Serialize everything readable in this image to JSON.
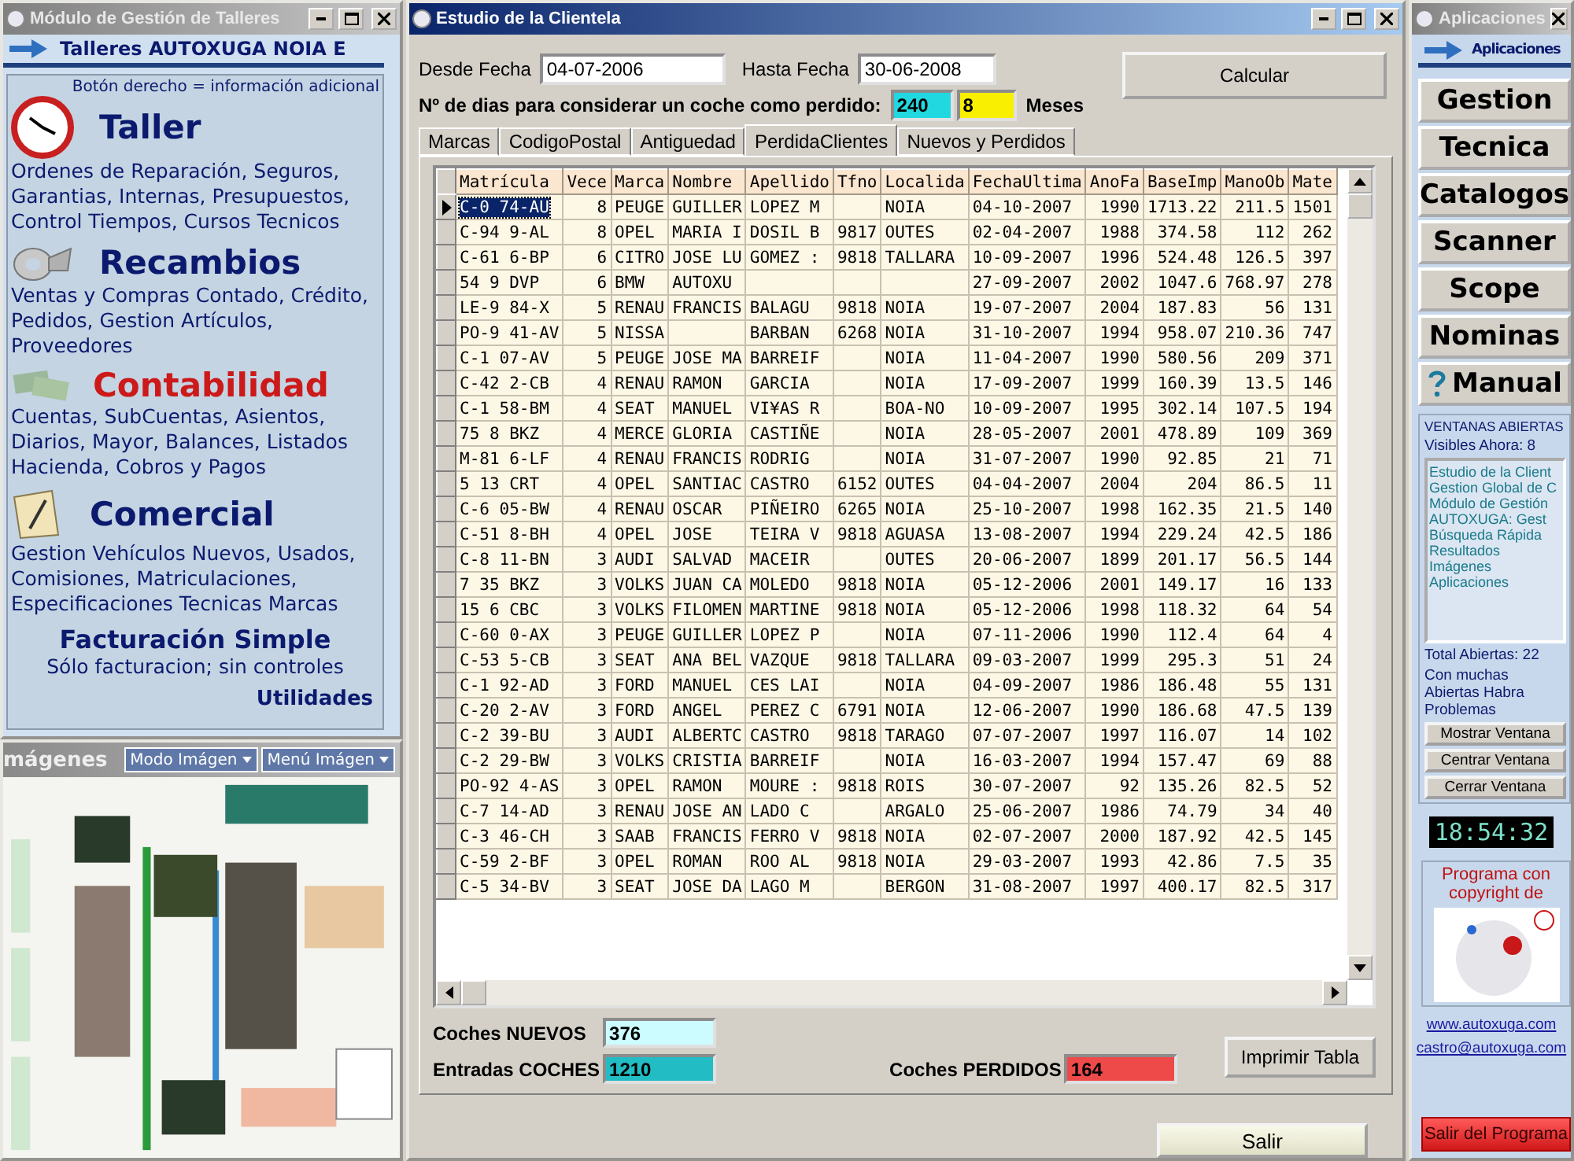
{
  "left_window": {
    "title": "Módulo de Gestión de Talleres",
    "header": "Talleres AUTOXUGA NOIA E",
    "hint": "Botón derecho = información adicional",
    "modules": [
      {
        "title": "Taller",
        "kind": "clock",
        "color": "#0b1a6e",
        "description": "Ordenes de Reparación, Seguros, Garantias, Internas, Presupuestos, Control Tiempos, Cursos Tecnicos"
      },
      {
        "title": "Recambios",
        "kind": "part",
        "color": "#0b1a6e",
        "description": "Ventas y Compras Contado, Crédito, Pedidos,  Gestion Artículos, Proveedores"
      },
      {
        "title": "Contabilidad",
        "kind": "money",
        "color": "#cc1a1a",
        "description": "Cuentas, SubCuentas, Asientos, Diarios, Mayor, Balances, Listados Hacienda, Cobros y Pagos"
      },
      {
        "title": "Comercial",
        "kind": "notepad",
        "color": "#0b1a6e",
        "description": "Gestion Vehículos Nuevos, Usados, Comisiones, Matriculaciones, Especificaciones Tecnicas Marcas"
      }
    ],
    "simple": {
      "title": "Facturación Simple",
      "description": "Sólo facturacion; sin controles"
    },
    "utilities": "Utilidades"
  },
  "images_window": {
    "title": "mágenes",
    "menus": [
      "Modo Imágen",
      "Menú Imágen"
    ]
  },
  "main_window": {
    "title": "Estudio de la Clientela",
    "from": {
      "label": "Desde Fecha",
      "value": "04-07-2006"
    },
    "to": {
      "label": "Hasta Fecha",
      "value": "30-06-2008"
    },
    "days_label": "Nº de dias para considerar un coche como perdido:",
    "days": "240",
    "months": "8",
    "months_label": "Meses",
    "calc_button": "Calcular",
    "tabs": [
      {
        "label": "Marcas",
        "selected": false
      },
      {
        "label": "CodigoPostal",
        "selected": false
      },
      {
        "label": "Antiguedad",
        "selected": false
      },
      {
        "label": "PerdidaClientes",
        "selected": true
      },
      {
        "label": "Nuevos y Perdidos",
        "selected": false
      }
    ],
    "table": {
      "columns": [
        "Matrícula",
        "Vece",
        "Marca",
        "Nombre",
        "Apellido",
        "Tfno",
        "Localida",
        "FechaUltima",
        "AnoFa",
        "BaseImp",
        "ManoOb",
        "Mate"
      ],
      "rows": [
        {
          "selected": true,
          "cells": [
            "C-0 74-AU",
            "8",
            "PEUGE",
            "GUILLER",
            "LOPEZ M",
            null,
            "NOIA",
            "04-10-2007",
            "1990",
            "1713.22",
            "211.5",
            "1501"
          ]
        },
        {
          "selected": false,
          "cells": [
            "C-94 9-AL",
            "8",
            "OPEL",
            "MARIA I",
            "DOSIL B",
            "9817",
            "OUTES",
            "02-04-2007",
            "1988",
            "374.58",
            "112",
            "262"
          ]
        },
        {
          "selected": false,
          "cells": [
            "C-61 6-BP",
            "6",
            "CITRO",
            "JOSE LU",
            "GOMEZ :",
            "9818",
            "TALLARA",
            "10-09-2007",
            "1996",
            "524.48",
            "126.5",
            "397"
          ]
        },
        {
          "selected": false,
          "cells": [
            "54 9 DVP",
            "6",
            "BMW",
            "AUTOXU",
            null,
            null,
            null,
            "27-09-2007",
            "2002",
            "1047.6",
            "768.97",
            "278"
          ]
        },
        {
          "selected": false,
          "cells": [
            "LE-9 84-X",
            "5",
            "RENAU",
            "FRANCIS",
            "BALAGU",
            "9818",
            "NOIA",
            "19-07-2007",
            "2004",
            "187.83",
            "56",
            "131"
          ]
        },
        {
          "selected": false,
          "cells": [
            "PO-9 41-AV",
            "5",
            "NISSA",
            null,
            "BARBAN",
            "6268",
            "NOIA",
            "31-10-2007",
            "1994",
            "958.07",
            "210.36",
            "747"
          ]
        },
        {
          "selected": false,
          "cells": [
            "C-1 07-AV",
            "5",
            "PEUGE",
            "JOSE MA",
            "BARREIF",
            null,
            "NOIA",
            "11-04-2007",
            "1990",
            "580.56",
            "209",
            "371"
          ]
        },
        {
          "selected": false,
          "cells": [
            "C-42 2-CB",
            "4",
            "RENAU",
            "RAMON",
            "GARCIA",
            null,
            "NOIA",
            "17-09-2007",
            "1999",
            "160.39",
            "13.5",
            "146"
          ]
        },
        {
          "selected": false,
          "cells": [
            "C-1 58-BM",
            "4",
            "SEAT",
            "MANUEL",
            "VI¥AS R",
            null,
            "BOA-NO",
            "10-09-2007",
            "1995",
            "302.14",
            "107.5",
            "194"
          ]
        },
        {
          "selected": false,
          "cells": [
            "75 8 BKZ",
            "4",
            "MERCE",
            "GLORIA",
            "CASTIÑE",
            null,
            "NOIA",
            "28-05-2007",
            "2001",
            "478.89",
            "109",
            "369"
          ]
        },
        {
          "selected": false,
          "cells": [
            "M-81 6-LF",
            "4",
            "RENAU",
            "FRANCIS",
            "RODRIG",
            null,
            "NOIA",
            "31-07-2007",
            "1990",
            "92.85",
            "21",
            "71"
          ]
        },
        {
          "selected": false,
          "cells": [
            "5 13 CRT",
            "4",
            "OPEL",
            "SANTIAC",
            "CASTRO",
            "6152",
            "OUTES",
            "04-04-2007",
            "2004",
            "204",
            "86.5",
            "11"
          ]
        },
        {
          "selected": false,
          "cells": [
            "C-6 05-BW",
            "4",
            "RENAU",
            "OSCAR",
            "PIÑEIRO",
            "6265",
            "NOIA",
            "25-10-2007",
            "1998",
            "162.35",
            "21.5",
            "140"
          ]
        },
        {
          "selected": false,
          "cells": [
            "C-51 8-BH",
            "4",
            "OPEL",
            "JOSE",
            "TEIRA V",
            "9818",
            "AGUASA",
            "13-08-2007",
            "1994",
            "229.24",
            "42.5",
            "186"
          ]
        },
        {
          "selected": false,
          "cells": [
            "C-8 11-BN",
            "3",
            "AUDI",
            "SALVAD",
            "MACEIR",
            null,
            "OUTES",
            "20-06-2007",
            "1899",
            "201.17",
            "56.5",
            "144"
          ]
        },
        {
          "selected": false,
          "cells": [
            "7 35 BKZ",
            "3",
            "VOLKS",
            "JUAN CA",
            "MOLEDO",
            "9818",
            "NOIA",
            "05-12-2006",
            "2001",
            "149.17",
            "16",
            "133"
          ]
        },
        {
          "selected": false,
          "cells": [
            "15 6 CBC",
            "3",
            "VOLKS",
            "FILOMEN",
            "MARTINE",
            "9818",
            "NOIA",
            "05-12-2006",
            "1998",
            "118.32",
            "64",
            "54"
          ]
        },
        {
          "selected": false,
          "cells": [
            "C-60 0-AX",
            "3",
            "PEUGE",
            "GUILLER",
            "LOPEZ P",
            null,
            "NOIA",
            "07-11-2006",
            "1990",
            "112.4",
            "64",
            "4"
          ]
        },
        {
          "selected": false,
          "cells": [
            "C-53 5-CB",
            "3",
            "SEAT",
            "ANA BEL",
            "VAZQUE",
            "9818",
            "TALLARA",
            "09-03-2007",
            "1999",
            "295.3",
            "51",
            "24"
          ]
        },
        {
          "selected": false,
          "cells": [
            "C-1 92-AD",
            "3",
            "FORD",
            "MANUEL",
            "CES LAI",
            null,
            "NOIA",
            "04-09-2007",
            "1986",
            "186.48",
            "55",
            "131"
          ]
        },
        {
          "selected": false,
          "cells": [
            "C-20 2-AV",
            "3",
            "FORD",
            "ANGEL",
            "PEREZ C",
            "6791",
            "NOIA",
            "12-06-2007",
            "1990",
            "186.68",
            "47.5",
            "139"
          ]
        },
        {
          "selected": false,
          "cells": [
            "C-2 39-BU",
            "3",
            "AUDI",
            "ALBERTC",
            "CASTRO",
            "9818",
            "TARAGO",
            "07-07-2007",
            "1997",
            "116.07",
            "14",
            "102"
          ]
        },
        {
          "selected": false,
          "cells": [
            "C-2 29-BW",
            "3",
            "VOLKS",
            "CRISTIA",
            "BARREIF",
            null,
            "NOIA",
            "16-03-2007",
            "1994",
            "157.47",
            "69",
            "88"
          ]
        },
        {
          "selected": false,
          "cells": [
            "PO-92 4-AS",
            "3",
            "OPEL",
            "RAMON",
            "MOURE :",
            "9818",
            "ROIS",
            "30-07-2007",
            "92",
            "135.26",
            "82.5",
            "52"
          ]
        },
        {
          "selected": false,
          "cells": [
            "C-7 14-AD",
            "3",
            "RENAU",
            "JOSE AN",
            "LADO C",
            null,
            "ARGALO",
            "25-06-2007",
            "1986",
            "74.79",
            "34",
            "40"
          ]
        },
        {
          "selected": false,
          "cells": [
            "C-3 46-CH",
            "3",
            "SAAB",
            "FRANCIS",
            "FERRO V",
            "9818",
            "NOIA",
            "02-07-2007",
            "2000",
            "187.92",
            "42.5",
            "145"
          ]
        },
        {
          "selected": false,
          "cells": [
            "C-59 2-BF",
            "3",
            "OPEL",
            "ROMAN",
            "ROO AL",
            "9818",
            "NOIA",
            "29-03-2007",
            "1993",
            "42.86",
            "7.5",
            "35"
          ]
        },
        {
          "selected": false,
          "cells": [
            "C-5 34-BV",
            "3",
            "SEAT",
            "JOSE DA",
            "LAGO M",
            null,
            "BERGON",
            "31-08-2007",
            "1997",
            "400.17",
            "82.5",
            "317"
          ]
        }
      ]
    },
    "stats": [
      {
        "label": "Coches NUEVOS",
        "value": "376",
        "color": "#ccfcff"
      },
      {
        "label": "Entradas COCHES",
        "value": "1210",
        "color": "#22bcc4"
      },
      {
        "label": "Coches PERDIDOS",
        "value": "164",
        "color": "#ee4a4a"
      }
    ],
    "print_button": "Imprimir Tabla",
    "exit_button": "Salir"
  },
  "right_window": {
    "title": "Aplicaciones",
    "header": "Aplicaciones",
    "apps": [
      {
        "label": "Gestion",
        "kind": "plain"
      },
      {
        "label": "Tecnica",
        "kind": "plain"
      },
      {
        "label": "Catalogos",
        "kind": "plain"
      },
      {
        "label": "Scanner",
        "kind": "plain"
      },
      {
        "label": "Scope",
        "kind": "plain"
      },
      {
        "label": "Nominas",
        "kind": "plain"
      },
      {
        "label": "Manual",
        "kind": "help"
      }
    ],
    "open_windows": {
      "title": "VENTANAS ABIERTAS",
      "visible": "Visibles Ahora: 8",
      "items": [
        "Estudio de la Client",
        "Gestion Global de C",
        "Módulo de Gestión",
        "AUTOXUGA:  Gest",
        "Búsqueda Rápida",
        "Resultados",
        "Imágenes",
        "Aplicaciones"
      ],
      "total": "Total Abiertas: 22",
      "warning": "Con muchas Abiertas Habra Problemas",
      "buttons": [
        "Mostrar Ventana",
        "Centrar Ventana",
        "Cerrar Ventana"
      ]
    },
    "clock": "18:54:32",
    "copyright": "Programa con copyright de",
    "links": [
      "www.autoxuga.com",
      "castro@autoxuga.com"
    ],
    "exit": "Salir del Programa"
  }
}
